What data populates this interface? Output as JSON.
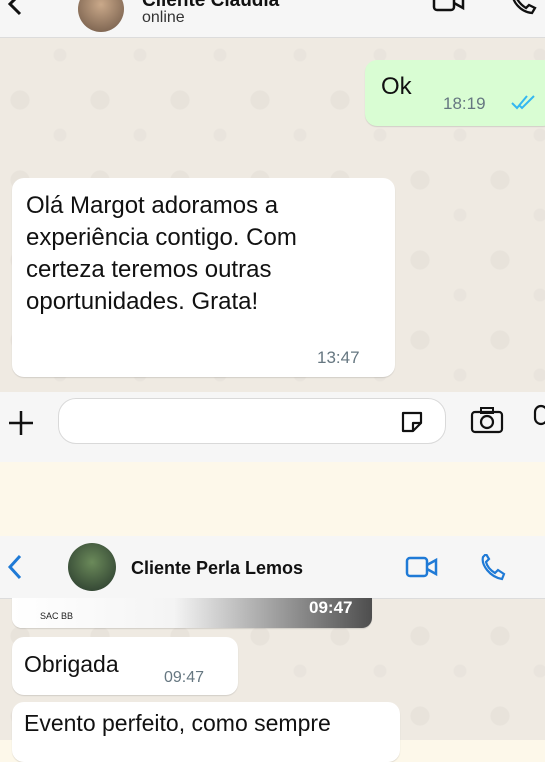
{
  "top_chat": {
    "contact_name": "Cliente Claudia",
    "status": "online",
    "messages": [
      {
        "text": "Ok",
        "time": "18:19",
        "outgoing": true
      },
      {
        "text": "Olá Margot adoramos a experiência contigo. Com certeza teremos outras oportunidades. Grata!",
        "time": "13:47",
        "outgoing": false
      }
    ],
    "input_placeholder": ""
  },
  "bottom_chat": {
    "contact_name": "Cliente Perla Lemos",
    "image_caption": "SAC BB",
    "image_time": "09:47",
    "messages": [
      {
        "text": "Obrigada",
        "time": "09:47"
      },
      {
        "text": "Evento perfeito, como sempre"
      }
    ]
  },
  "colors": {
    "accent_blue": "#1f7ad6",
    "outgoing_bubble": "#d9fdd3",
    "read_ticks": "#34b7f1"
  },
  "icons": [
    "back-chevron-icon",
    "video-call-icon",
    "phone-icon",
    "plus-icon",
    "sticker-icon",
    "camera-icon",
    "mic-icon",
    "double-check-icon"
  ]
}
